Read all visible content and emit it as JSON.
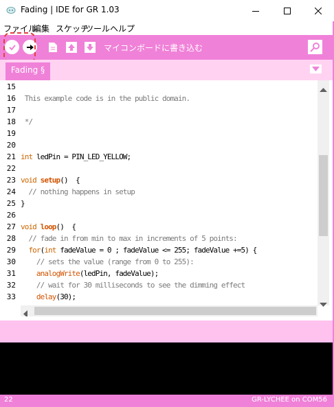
{
  "window": {
    "title": "Fading | IDE for GR 1.03",
    "controls": [
      "minimize",
      "maximize",
      "close"
    ]
  },
  "menu": [
    "ファイル",
    "編集",
    "スケッチ",
    "ツール",
    "ヘルプ"
  ],
  "toolbar": {
    "buttons": [
      "verify-icon",
      "upload-icon",
      "new-icon",
      "open-icon",
      "save-icon"
    ],
    "status_text": "マイコンボードに書き込む",
    "right_icon": "serial-monitor-icon",
    "highlight_color": "#e2403c",
    "accent": "#f081d8"
  },
  "tab": {
    "label": "Fading §"
  },
  "editor": {
    "lines": [
      {
        "n": "15",
        "t": ""
      },
      {
        "n": "16",
        "t": " This example code is in the public domain."
      },
      {
        "n": "17",
        "t": ""
      },
      {
        "n": "18",
        "t": " */"
      },
      {
        "n": "19",
        "t": ""
      },
      {
        "n": "20",
        "t": ""
      },
      {
        "n": "21",
        "t": "int ledPin = PIN_LED_YELLOW;"
      },
      {
        "n": "22",
        "t": ""
      },
      {
        "n": "23",
        "t": "void setup()  {"
      },
      {
        "n": "24",
        "t": "  // nothing happens in setup"
      },
      {
        "n": "25",
        "t": "}"
      },
      {
        "n": "26",
        "t": ""
      },
      {
        "n": "27",
        "t": "void loop()  {"
      },
      {
        "n": "28",
        "t": "  // fade in from min to max in increments of 5 points:"
      },
      {
        "n": "29",
        "t": "  for(int fadeValue = 0 ; fadeValue <= 255; fadeValue +=5) {"
      },
      {
        "n": "30",
        "t": "    // sets the value (range from 0 to 255):"
      },
      {
        "n": "31",
        "t": "    analogWrite(ledPin, fadeValue);"
      },
      {
        "n": "32",
        "t": "    // wait for 30 milliseconds to see the dimming effect"
      },
      {
        "n": "33",
        "t": "    delay(30);"
      }
    ]
  },
  "status": {
    "line": "22",
    "board": "GR-LYCHEE on COM56"
  }
}
